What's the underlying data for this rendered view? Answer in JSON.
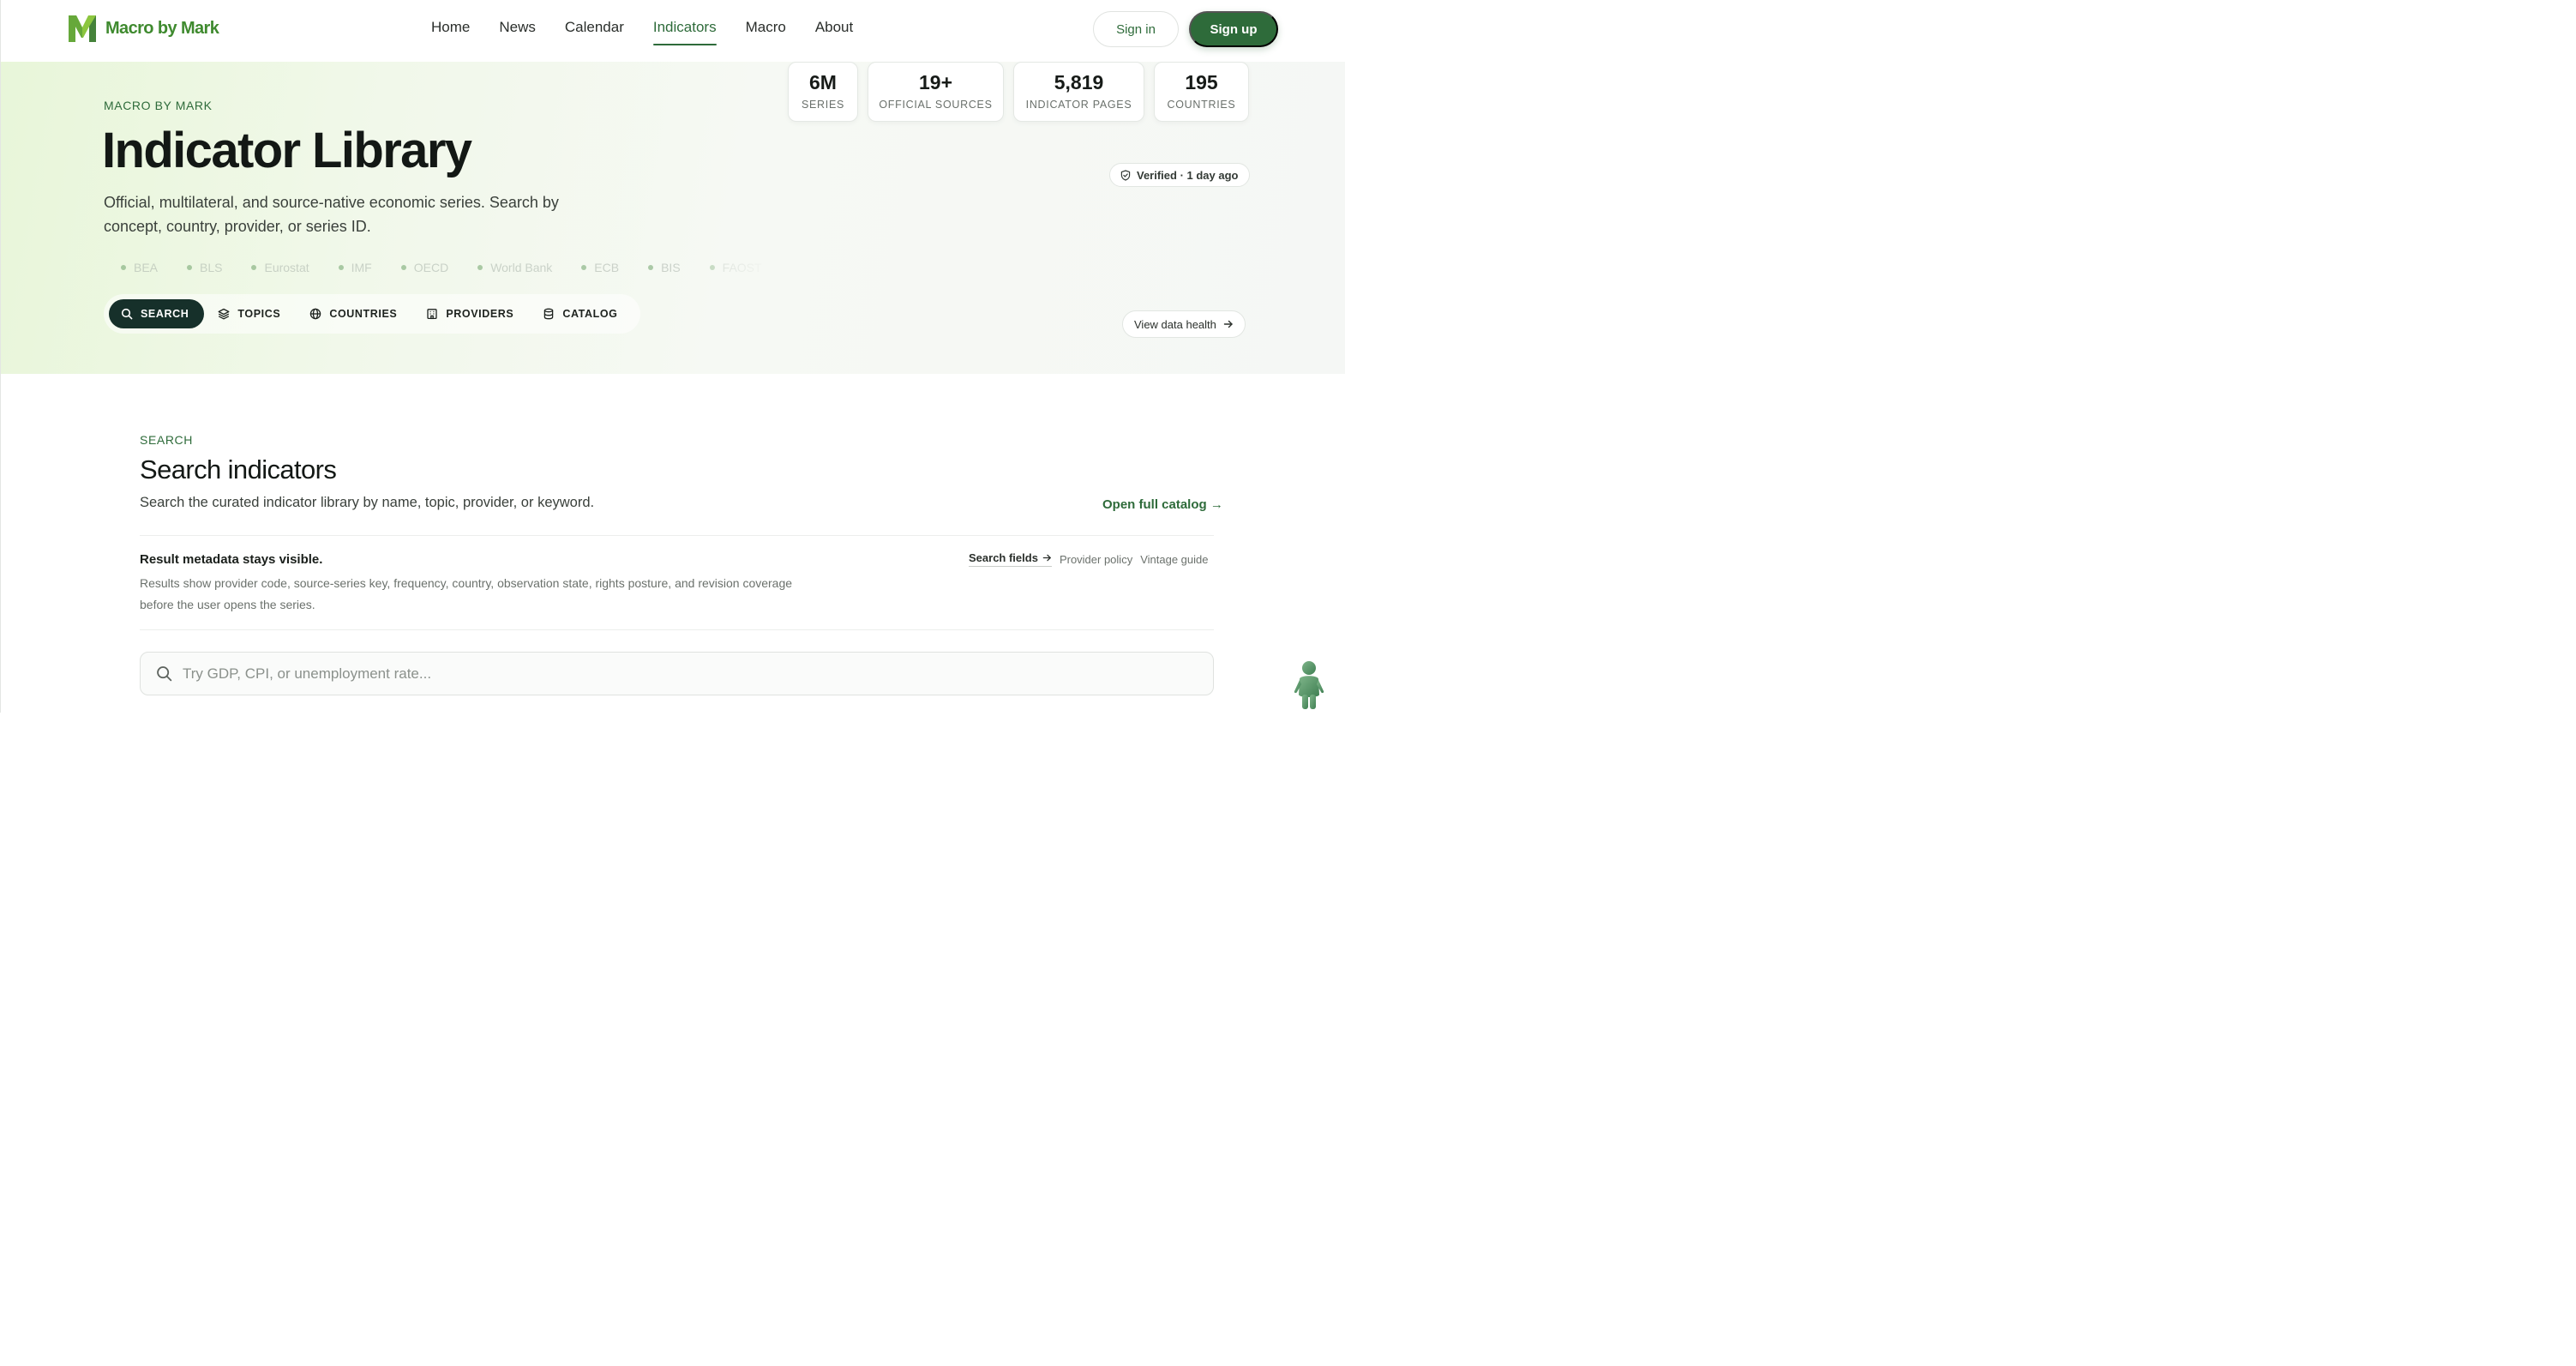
{
  "brand": {
    "name": "Macro by Mark",
    "colors": {
      "primary": "#2e6b3a",
      "logo_green": "#8cc63f",
      "dark": "#16302a"
    }
  },
  "nav": {
    "items": [
      {
        "label": "Home",
        "active": false
      },
      {
        "label": "News",
        "active": false
      },
      {
        "label": "Calendar",
        "active": false
      },
      {
        "label": "Indicators",
        "active": true
      },
      {
        "label": "Macro",
        "active": false
      },
      {
        "label": "About",
        "active": false
      }
    ],
    "sign_in": "Sign in",
    "sign_up": "Sign up"
  },
  "hero": {
    "eyebrow": "MACRO BY MARK",
    "title": "Indicator Library",
    "subtitle": "Official, multilateral, and source-native economic series. Search by concept, country, provider, or series ID.",
    "sources": [
      "BEA",
      "BLS",
      "Eurostat",
      "IMF",
      "OECD",
      "World Bank",
      "ECB",
      "BIS",
      "FAOST"
    ],
    "tabs": [
      {
        "label": "SEARCH",
        "icon": "search-icon",
        "active": true
      },
      {
        "label": "TOPICS",
        "icon": "layers-icon",
        "active": false
      },
      {
        "label": "COUNTRIES",
        "icon": "globe-icon",
        "active": false
      },
      {
        "label": "PROVIDERS",
        "icon": "building-icon",
        "active": false
      },
      {
        "label": "CATALOG",
        "icon": "database-icon",
        "active": false
      }
    ],
    "stats": [
      {
        "value": "6M",
        "label": "SERIES"
      },
      {
        "value": "19+",
        "label": "OFFICIAL SOURCES"
      },
      {
        "value": "5,819",
        "label": "INDICATOR PAGES"
      },
      {
        "value": "195",
        "label": "COUNTRIES"
      }
    ],
    "verified": "Verified · 1 day ago",
    "health_link": "View data health"
  },
  "search_section": {
    "eyebrow": "SEARCH",
    "title": "Search indicators",
    "subtitle": "Search the curated indicator library by name, topic, provider, or keyword.",
    "open_catalog": "Open full catalog →",
    "meta_title": "Result metadata stays visible.",
    "meta_body": "Results show provider code, source-series key, frequency, country, observation state, rights posture, and revision coverage before the user opens the series.",
    "links": {
      "search_fields": "Search fields",
      "provider_policy": "Provider policy",
      "vintage_guide": "Vintage guide"
    },
    "search_placeholder": "Try GDP, CPI, or unemployment rate..."
  }
}
